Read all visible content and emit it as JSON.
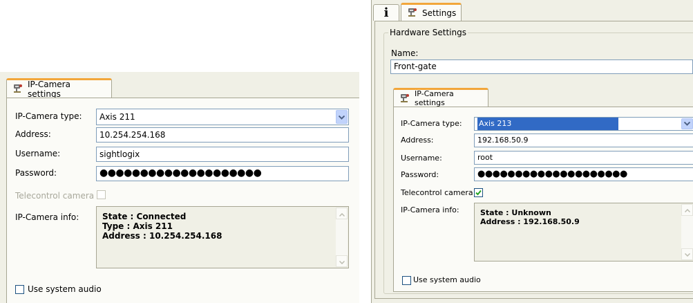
{
  "left": {
    "tab_label": "IP-Camera settings",
    "labels": {
      "type": "IP-Camera type:",
      "address": "Address:",
      "username": "Username:",
      "password": "Password:",
      "telecontrol": "Telecontrol camera",
      "info": "IP-Camera info:"
    },
    "camera_type": "Axis 211",
    "address": "10.254.254.168",
    "username": "sightlogix",
    "password_mask": "●●●●●●●●●●●●●●●●●●●●",
    "telecontrol_checked": false,
    "info_lines": [
      "State : Connected",
      "Type : Axis 211",
      "Address : 10.254.254.168"
    ],
    "use_system_audio": "Use system audio"
  },
  "right": {
    "tabs": [
      {
        "label": "",
        "icon": "info-icon"
      },
      {
        "label": "Settings",
        "icon": "camera-icon"
      }
    ],
    "group_title": "Hardware Settings",
    "name_label": "Name:",
    "name_value": "Front-gate",
    "tab_label": "IP-Camera settings",
    "labels": {
      "type": "IP-Camera type:",
      "address": "Address:",
      "username": "Username:",
      "password": "Password:",
      "telecontrol": "Telecontrol camera",
      "info": "IP-Camera info:"
    },
    "camera_type": "Axis 213",
    "address": "192.168.50.9",
    "username": "root",
    "password_mask": "●●●●●●●●●●●●●●●●●●●●",
    "telecontrol_checked": true,
    "info_lines": [
      "State : Unknown",
      "Address : 192.168.50.9"
    ],
    "use_system_audio": "Use system audio"
  },
  "colors": {
    "panel": "#f0f0e6",
    "tab_accent": "#f2a63a",
    "selection": "#316ac5",
    "check": "#21a121"
  }
}
